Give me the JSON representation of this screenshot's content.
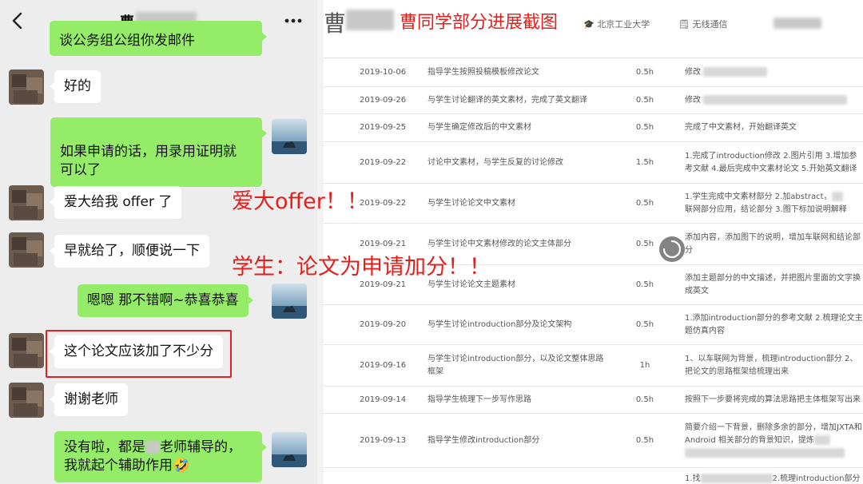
{
  "chat": {
    "title": "曹",
    "messages": [
      {
        "side": "right",
        "text": "谈公务组公组你发邮件"
      },
      {
        "side": "left",
        "text": "好的"
      },
      {
        "side": "right",
        "text": "如果申请的话，用录用证明就\n可以了"
      },
      {
        "side": "left",
        "text": "爱大给我 offer 了"
      },
      {
        "side": "left",
        "text": "早就给了，顺便说一下"
      },
      {
        "side": "right",
        "text": "嗯嗯 那不错啊~恭喜恭喜"
      },
      {
        "side": "left",
        "text": "这个论文应该加了不少分"
      },
      {
        "side": "left",
        "text": "谢谢老师"
      },
      {
        "side": "right",
        "text": "没有啦，都是",
        "text_b": "老师辅导的，",
        "text_c": "我就起个辅助作用🤣"
      }
    ]
  },
  "panel": {
    "name": "曹",
    "caption": "曹同学部分进展截图",
    "school": "北京工业大学",
    "department": "无线通信",
    "rows": [
      {
        "date": "2019-10-06",
        "task": "指导学生按照投稿模板修改论文",
        "hours": "0.5h",
        "note": "修改"
      },
      {
        "date": "2019-09-26",
        "task": "与学生讨论翻译的英文素材，完成了英文翻译",
        "hours": "0.5h",
        "note": "修改"
      },
      {
        "date": "2019-09-25",
        "task": "与学生确定修改后的中文素材",
        "hours": "0.5h",
        "note": "完成了中文素材，开始翻译英文"
      },
      {
        "date": "2019-09-22",
        "task": "讨论中文素材，与学生反复的讨论修改",
        "hours": "1.5h",
        "note": "1.完成了introduction修改 2.图片引用 3.增加参考文献 4.最后完成中文素材论文 5.开始英文翻译"
      },
      {
        "date": "2019-09-22",
        "task": "与学生讨论论文中文素材",
        "hours": "0.5h",
        "note": "1.学生完成中文素材部分 2.加abstract，",
        "note_b": "联网部分应用，结论部分 3.图下标加说明解释"
      },
      {
        "date": "2019-09-21",
        "task": "与学生讨论中文素材修改的论文主体部分",
        "hours": "0.5h",
        "note": "添加内容，添加图下的说明，增加车联网和结论部分"
      },
      {
        "date": "2019-09-21",
        "task": "与学生讨论论文主题素材",
        "hours": "0.5h",
        "note": "添加主题部分的中文描述，并把图片里面的文字换成英文"
      },
      {
        "date": "2019-09-20",
        "task": "与学生讨论introduction部分及论文架构",
        "hours": "0.5h",
        "note": "1.添加introduction部分的参考文献 2.梳理论文主题仿真内容"
      },
      {
        "date": "2019-09-16",
        "task": "与学生讨论introduction部分，以及论文整体思路框架",
        "hours": "1h",
        "note": "1、以车联网为背景，梳理introduction部分 2、把论文的思路框架给梳理出来"
      },
      {
        "date": "2019-09-14",
        "task": "指导学生梳理下一步写作思路",
        "hours": "0.5h",
        "note": "按照下一步要将完成的算法思路把主体框架写出来"
      },
      {
        "date": "2019-09-13",
        "task": "指导学生修改introduction部分",
        "hours": "0.5h",
        "note": "简要介绍一下背景，删除多余的部分，增加JXTA和Android 相关部分的背景知识，提炼"
      },
      {
        "date": "",
        "task": "",
        "hours": "",
        "note": "1.找",
        "note_b": "2.梳理introduction部分"
      }
    ]
  },
  "annotations": {
    "offer": "爱大offer！！",
    "points": "学生：论文为申请加分！！"
  },
  "colors": {
    "annotation_red": "#e0201c",
    "chat_green": "#95ec69",
    "chat_bg": "#ededed"
  }
}
